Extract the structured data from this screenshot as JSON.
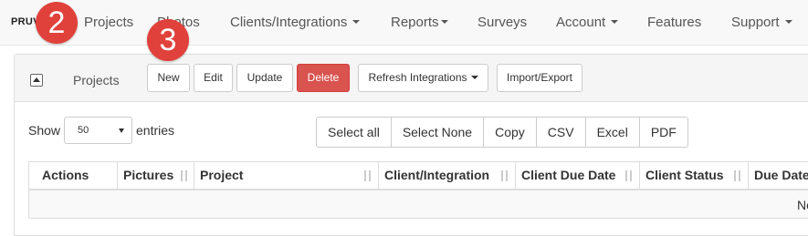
{
  "nav": {
    "brand": "PRUV",
    "items": [
      {
        "label": "Projects"
      },
      {
        "label": "Photos"
      },
      {
        "label": "Clients/Integrations",
        "dropdown": true
      },
      {
        "label": "Reports",
        "dropdown": true
      },
      {
        "label": "Surveys"
      },
      {
        "label": "Account",
        "dropdown": true
      },
      {
        "label": "Features"
      },
      {
        "label": "Support",
        "dropdown": true
      }
    ]
  },
  "badges": [
    "2",
    "3"
  ],
  "badge_color": "#e0413a",
  "panel": {
    "title": "Projects",
    "collapse_icon": "collapse-up-icon",
    "buttons": {
      "new": "New",
      "edit": "Edit",
      "update": "Update",
      "delete": "Delete",
      "refresh": "Refresh Integrations",
      "import_export": "Import/Export"
    },
    "danger_color": "#d9534f"
  },
  "entries": {
    "show": "Show",
    "value": "50",
    "suffix": "entries"
  },
  "export_buttons": [
    "Select all",
    "Select None",
    "Copy",
    "CSV",
    "Excel",
    "PDF"
  ],
  "table": {
    "columns": [
      "Actions",
      "Pictures",
      "Project",
      "Client/Integration",
      "Client Due Date",
      "Client Status",
      "Due Date"
    ],
    "empty_text": "No"
  }
}
